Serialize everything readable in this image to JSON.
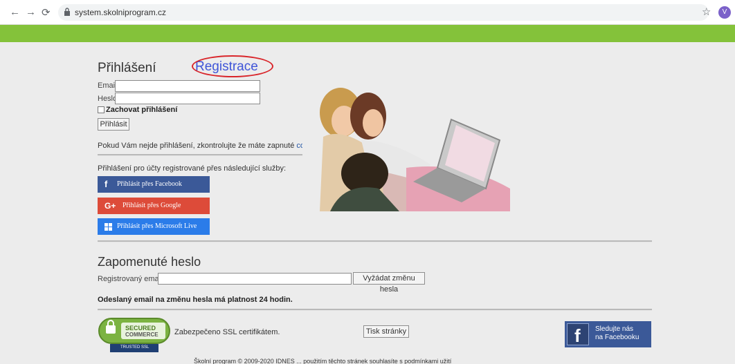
{
  "browser": {
    "url": "system.skolniprogram.cz",
    "avatar_letter": "V"
  },
  "login": {
    "title": "Přihlášení",
    "register_link": "Registrace",
    "email_label": "Email",
    "password_label": "Heslo",
    "remember_label": "Zachovat přihlášení",
    "login_button": "Přihlásit",
    "cookie_note": "Pokud Vám nejde přihlášení, zkontrolujte že máte zapnuté ",
    "cookie_link": "cookies",
    "services_label": "Přihlášení pro účty registrované přes následující služby:",
    "services": [
      {
        "label": "Přihlásit přes Facebook",
        "icon": "facebook-icon",
        "color": "#3b5998"
      },
      {
        "label": "Přihlásit přes Google",
        "icon": "google-plus-icon",
        "color": "#dd4b39"
      },
      {
        "label": "Přihlásit přes Microsoft Live",
        "icon": "windows-icon",
        "color": "#2b7ce9"
      }
    ]
  },
  "forgot": {
    "title": "Zapomenuté heslo",
    "email_label": "Registrovaný email",
    "button": "Vyžádat změnu hesla",
    "note": "Odeslaný email na změnu hesla má platnost 24 hodin."
  },
  "footer": {
    "ssl_badge_line1": "SECURED",
    "ssl_badge_line2": "COMMERCE",
    "ssl_badge_line3": "TRUSTED SSL",
    "ssl_text": "Zabezpečeno SSL certifikátem.",
    "print_button": "Tisk stránky",
    "facebook_line1": "Sledujte nás",
    "facebook_line2": "na Facebooku",
    "bottom_text": "Školní program © 2009-2020 IDNES ... použitím těchto stránek souhlasíte s podmínkami užití"
  },
  "colors": {
    "green_bar": "#84c23a",
    "register_link": "#3f55d8",
    "highlight_oval": "#d9252a"
  }
}
